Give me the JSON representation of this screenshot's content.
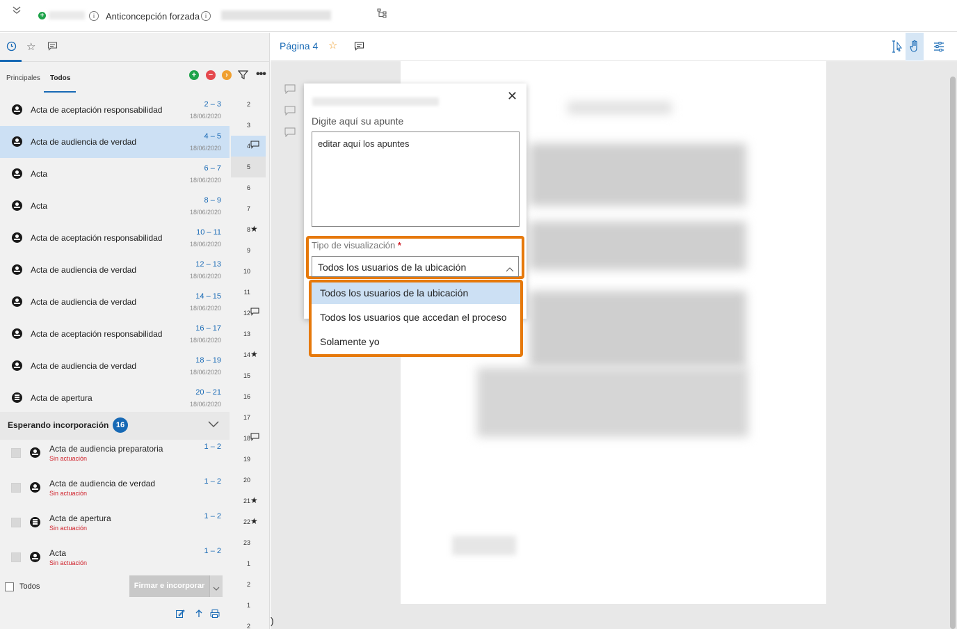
{
  "topbar": {
    "case_title": "Anticoncepción forzada"
  },
  "left_panel": {
    "tabs": [
      "Principales",
      "Todos"
    ],
    "documents": [
      {
        "name": "Acta de aceptación responsabilidad",
        "range": "2 – 3",
        "date": "18/06/2020",
        "icon": "person-icon"
      },
      {
        "name": "Acta de audiencia de verdad",
        "range": "4 – 5",
        "date": "18/06/2020",
        "icon": "person-icon"
      },
      {
        "name": "Acta",
        "range": "6 – 7",
        "date": "18/06/2020",
        "icon": "person-icon"
      },
      {
        "name": "Acta",
        "range": "8 – 9",
        "date": "18/06/2020",
        "icon": "person-icon"
      },
      {
        "name": "Acta de aceptación responsabilidad",
        "range": "10 – 11",
        "date": "18/06/2020",
        "icon": "person-icon"
      },
      {
        "name": "Acta de audiencia de verdad",
        "range": "12 – 13",
        "date": "18/06/2020",
        "icon": "person-icon"
      },
      {
        "name": "Acta de audiencia de verdad",
        "range": "14 – 15",
        "date": "18/06/2020",
        "icon": "person-icon"
      },
      {
        "name": "Acta de aceptación responsabilidad",
        "range": "16 – 17",
        "date": "18/06/2020",
        "icon": "person-icon"
      },
      {
        "name": "Acta de audiencia de verdad",
        "range": "18 – 19",
        "date": "18/06/2020",
        "icon": "person-icon"
      },
      {
        "name": "Acta de apertura",
        "range": "20 – 21",
        "date": "18/06/2020",
        "icon": "page-icon"
      }
    ],
    "pages": [
      {
        "n": "2",
        "mark": ""
      },
      {
        "n": "3",
        "mark": ""
      },
      {
        "n": "4",
        "mark": "note"
      },
      {
        "n": "5",
        "mark": ""
      },
      {
        "n": "6",
        "mark": ""
      },
      {
        "n": "7",
        "mark": ""
      },
      {
        "n": "8",
        "mark": "star"
      },
      {
        "n": "9",
        "mark": ""
      },
      {
        "n": "10",
        "mark": ""
      },
      {
        "n": "11",
        "mark": ""
      },
      {
        "n": "12",
        "mark": "note"
      },
      {
        "n": "13",
        "mark": ""
      },
      {
        "n": "14",
        "mark": "star"
      },
      {
        "n": "15",
        "mark": ""
      },
      {
        "n": "16",
        "mark": ""
      },
      {
        "n": "17",
        "mark": ""
      },
      {
        "n": "18",
        "mark": "note"
      },
      {
        "n": "19",
        "mark": ""
      },
      {
        "n": "20",
        "mark": ""
      },
      {
        "n": "21",
        "mark": "star"
      },
      {
        "n": "22",
        "mark": "star"
      },
      {
        "n": "23",
        "mark": ""
      },
      {
        "n": "1",
        "mark": ""
      },
      {
        "n": "2",
        "mark": ""
      },
      {
        "n": "1",
        "mark": ""
      },
      {
        "n": "2",
        "mark": ""
      }
    ],
    "waiting": {
      "title": "Esperando incorporación",
      "count": "16",
      "items": [
        {
          "name": "Acta de audiencia preparatoria",
          "status": "Sin actuación",
          "range": "1 – 2",
          "icon": "person-icon"
        },
        {
          "name": "Acta de audiencia de verdad",
          "status": "Sin actuación",
          "range": "1 – 2",
          "icon": "person-icon"
        },
        {
          "name": "Acta de apertura",
          "status": "Sin actuación",
          "range": "1 – 2",
          "icon": "page-icon"
        },
        {
          "name": "Acta",
          "status": "Sin actuación",
          "range": "1 – 2",
          "icon": "person-icon"
        }
      ]
    },
    "footer": {
      "select_all_label": "Todos",
      "sign_button": "Firmar e incorporar"
    }
  },
  "viewer": {
    "page_label": "Página 4",
    "paren": ")"
  },
  "note_dialog": {
    "note_label": "Digite aquí su apunte",
    "note_text": "editar aquí los apuntes",
    "visibility_label": "Tipo de visualización",
    "required_mark": "*",
    "selected_option": "Todos los usuarios de la ubicación",
    "options": [
      "Todos los usuarios de la ubicación",
      "Todos los usuarios que accedan el proceso",
      "Solamente yo"
    ]
  },
  "colors": {
    "accent": "#1769b5",
    "highlight": "#e6790b",
    "selected_row": "#cce0f4",
    "status_red": "#d0202a"
  }
}
